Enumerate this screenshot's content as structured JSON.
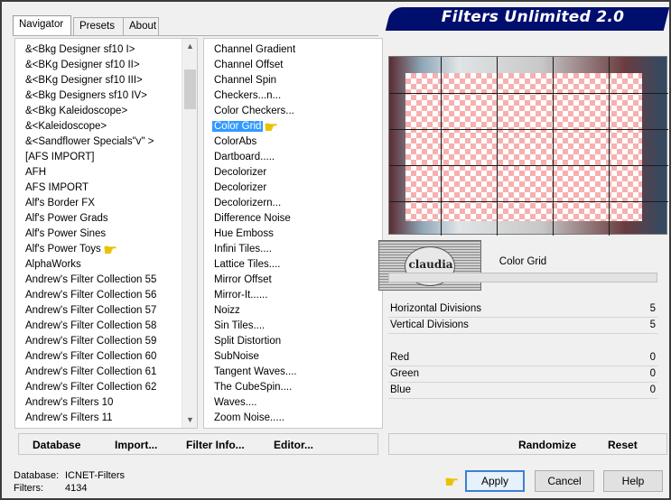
{
  "window": {
    "title": "Filters Unlimited 2.0",
    "tabs": [
      "Navigator",
      "Presets",
      "About"
    ]
  },
  "categories": [
    "&<Bkg Designer sf10 I>",
    "&<BKg Designer sf10 II>",
    "&<BKg Designer sf10 III>",
    "&<Bkg Designers sf10 IV>",
    "&<Bkg Kaleidoscope>",
    "&<Kaleidoscope>",
    "&<Sandflower Specials\"v\" >",
    "[AFS IMPORT]",
    "AFH",
    "AFS IMPORT",
    "Alf's Border FX",
    "Alf's Power Grads",
    "Alf's Power Sines",
    "Alf's Power Toys",
    "AlphaWorks",
    "Andrew's Filter Collection 55",
    "Andrew's Filter Collection 56",
    "Andrew's Filter Collection 57",
    "Andrew's Filter Collection 58",
    "Andrew's Filter Collection 59",
    "Andrew's Filter Collection 60",
    "Andrew's Filter Collection 61",
    "Andrew's Filter Collection 62",
    "Andrew's Filters 10",
    "Andrew's Filters 11"
  ],
  "filters": [
    "Channel Gradient",
    "Channel Offset",
    "Channel Spin",
    "Checkers...n...",
    "Color Checkers...",
    "Color Grid",
    "ColorAbs",
    "Dartboard.....",
    "Decolorizer",
    "Decolorizer",
    "Decolorizern...",
    "Difference Noise",
    "Hue Emboss",
    "Infini Tiles....",
    "Lattice Tiles....",
    "Mirror Offset",
    "Mirror-It......",
    "Noizz",
    "Sin Tiles....",
    "Split Distortion",
    "SubNoise",
    "Tangent Waves....",
    "The CubeSpin....",
    "Waves....",
    "Zoom Noise....."
  ],
  "logo_text": "claudia",
  "selected_filter": "Color Grid",
  "params": {
    "horizontal_label": "Horizontal Divisions",
    "horizontal_value": "5",
    "vertical_label": "Vertical Divisions",
    "vertical_value": "5",
    "red_label": "Red",
    "red_value": "0",
    "green_label": "Green",
    "green_value": "0",
    "blue_label": "Blue",
    "blue_value": "0"
  },
  "left_buttons": {
    "database": "Database",
    "import": "Import...",
    "filter_info": "Filter Info...",
    "editor": "Editor..."
  },
  "right_buttons": {
    "randomize": "Randomize",
    "reset": "Reset"
  },
  "status": {
    "database_label": "Database:",
    "database_value": "ICNET-Filters",
    "filters_label": "Filters:",
    "filters_value": "4134"
  },
  "dialog_buttons": {
    "apply": "Apply",
    "cancel": "Cancel",
    "help": "Help"
  },
  "colors": {
    "banner": "#000e6e",
    "selection": "#3399ff",
    "checker": "#f6b0b0"
  }
}
